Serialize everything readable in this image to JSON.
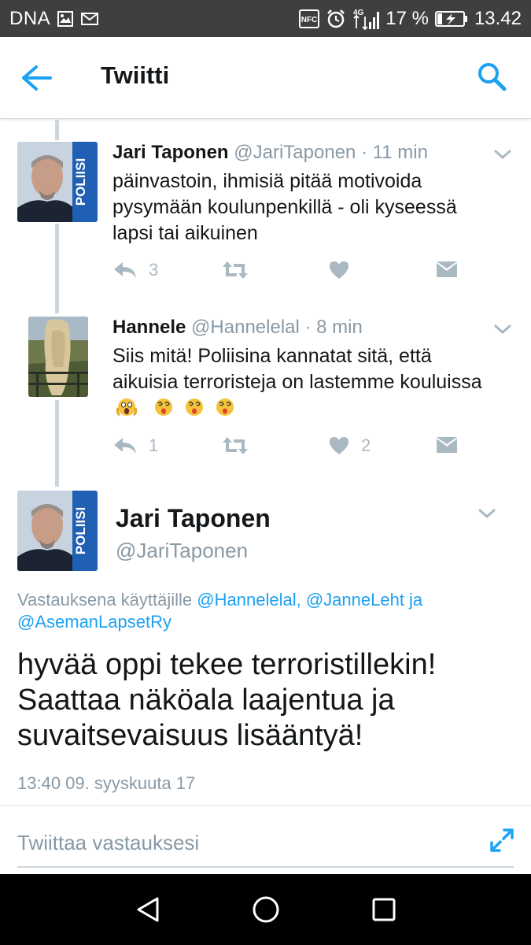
{
  "status_bar": {
    "carrier": "DNA",
    "icons": [
      "image-icon",
      "gmail-icon",
      "nfc-icon",
      "alarm-icon",
      "signal-4g-icon",
      "battery-charging-icon"
    ],
    "network": "4G",
    "battery": "17 %",
    "time": "13.42"
  },
  "app_bar": {
    "title": "Twiitti",
    "back_icon": "arrow-left-icon",
    "search_icon": "search-icon"
  },
  "colors": {
    "accent": "#1da1f2",
    "muted": "#8899a6",
    "icon_gray": "#aab8c2",
    "thread_line": "#ccd6dd",
    "statusbar": "#3f3f41"
  },
  "tweets": [
    {
      "name": "Jari Taponen",
      "handle": "@JariTaponen",
      "time": "· 11 min",
      "text": "päinvastoin, ihmisiä pitää motivoida pysymään koulunpenkillä - oli kyseessä lapsi tai aikuinen",
      "replies": "3",
      "retweets": "",
      "likes": ""
    },
    {
      "name": "Hannele",
      "handle": "@Hannelelal",
      "time": "· 8 min",
      "text": "Siis mitä! Poliisina kannatat sitä, että aikuisia terroristeja on lastemme kouluissa",
      "emojis": [
        "screaming-face-emoji",
        "dizzy-face-emoji",
        "dizzy-face-emoji",
        "dizzy-face-emoji"
      ],
      "replies": "1",
      "retweets": "",
      "likes": "2"
    }
  ],
  "avatar_badge": "POLIISI",
  "main_tweet": {
    "name": "Jari Taponen",
    "handle": "@JariTaponen",
    "reply_prefix": "Vastauksena käyttäjille",
    "reply_users": [
      "@Hannelelal,",
      "@JanneLeht ja",
      "@AsemanLapsetRy"
    ],
    "text": "hyvää oppi tekee terroristillekin! Saattaa näköala laajentua ja suvaitsevaisuus lisääntyä!",
    "date": "13:40 09. syyskuuta 17"
  },
  "reply_box": {
    "placeholder": "Twiittaa vastauksesi"
  },
  "nav_bar": {
    "icons": [
      "back-triangle-icon",
      "home-circle-icon",
      "recents-square-icon"
    ]
  }
}
